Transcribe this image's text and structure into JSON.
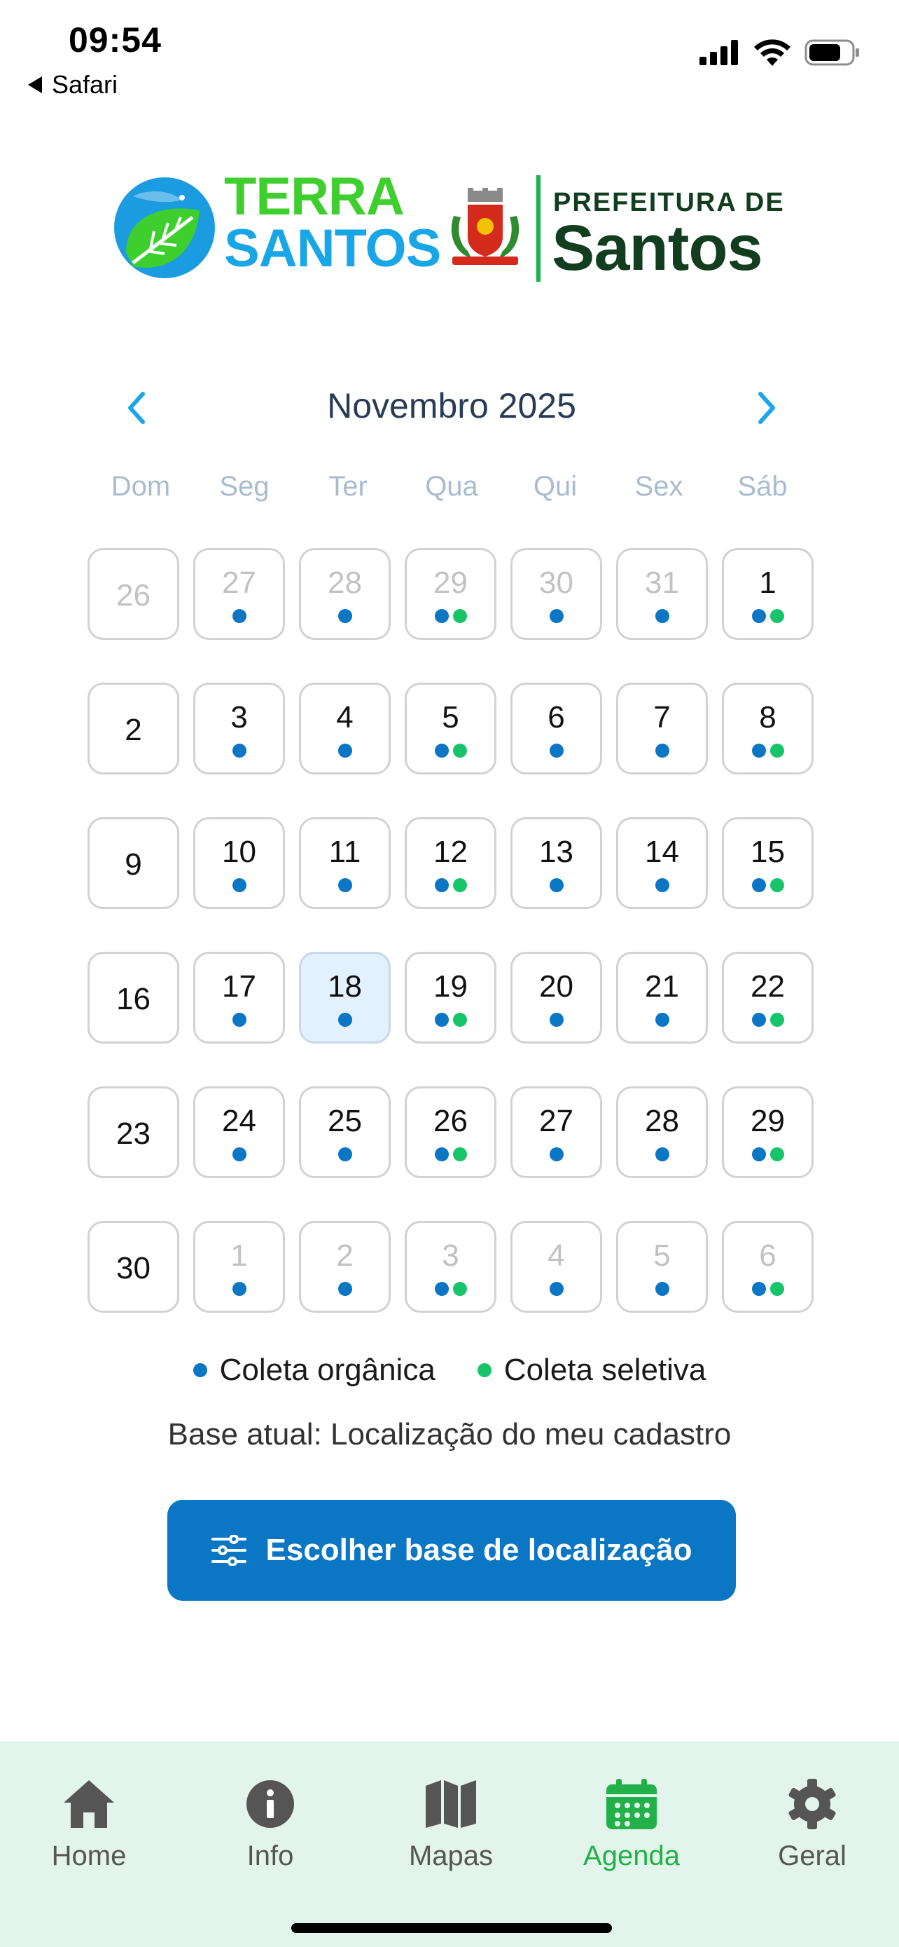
{
  "status_bar": {
    "time": "09:54",
    "back_app": "Safari"
  },
  "logos": {
    "terra_line1": "TERRA",
    "terra_line2": "SANTOS",
    "prefeitura_top": "PREFEITURA DE",
    "prefeitura_big": "Santos"
  },
  "calendar": {
    "month_title": "Novembro 2025",
    "weekdays": [
      "Dom",
      "Seg",
      "Ter",
      "Qua",
      "Qui",
      "Sex",
      "Sáb"
    ],
    "colors": {
      "organica": "#0a76c4",
      "seletiva": "#18c46a"
    },
    "days": [
      {
        "d": "26",
        "other": true,
        "dots": []
      },
      {
        "d": "27",
        "other": true,
        "dots": [
          "organica"
        ]
      },
      {
        "d": "28",
        "other": true,
        "dots": [
          "organica"
        ]
      },
      {
        "d": "29",
        "other": true,
        "dots": [
          "organica",
          "seletiva"
        ]
      },
      {
        "d": "30",
        "other": true,
        "dots": [
          "organica"
        ]
      },
      {
        "d": "31",
        "other": true,
        "dots": [
          "organica"
        ]
      },
      {
        "d": "1",
        "other": false,
        "dots": [
          "organica",
          "seletiva"
        ]
      },
      {
        "d": "2",
        "other": false,
        "dots": []
      },
      {
        "d": "3",
        "other": false,
        "dots": [
          "organica"
        ]
      },
      {
        "d": "4",
        "other": false,
        "dots": [
          "organica"
        ]
      },
      {
        "d": "5",
        "other": false,
        "dots": [
          "organica",
          "seletiva"
        ]
      },
      {
        "d": "6",
        "other": false,
        "dots": [
          "organica"
        ]
      },
      {
        "d": "7",
        "other": false,
        "dots": [
          "organica"
        ]
      },
      {
        "d": "8",
        "other": false,
        "dots": [
          "organica",
          "seletiva"
        ]
      },
      {
        "d": "9",
        "other": false,
        "dots": []
      },
      {
        "d": "10",
        "other": false,
        "dots": [
          "organica"
        ]
      },
      {
        "d": "11",
        "other": false,
        "dots": [
          "organica"
        ]
      },
      {
        "d": "12",
        "other": false,
        "dots": [
          "organica",
          "seletiva"
        ]
      },
      {
        "d": "13",
        "other": false,
        "dots": [
          "organica"
        ]
      },
      {
        "d": "14",
        "other": false,
        "dots": [
          "organica"
        ]
      },
      {
        "d": "15",
        "other": false,
        "dots": [
          "organica",
          "seletiva"
        ]
      },
      {
        "d": "16",
        "other": false,
        "dots": []
      },
      {
        "d": "17",
        "other": false,
        "dots": [
          "organica"
        ]
      },
      {
        "d": "18",
        "other": false,
        "selected": true,
        "dots": [
          "organica"
        ]
      },
      {
        "d": "19",
        "other": false,
        "dots": [
          "organica",
          "seletiva"
        ]
      },
      {
        "d": "20",
        "other": false,
        "dots": [
          "organica"
        ]
      },
      {
        "d": "21",
        "other": false,
        "dots": [
          "organica"
        ]
      },
      {
        "d": "22",
        "other": false,
        "dots": [
          "organica",
          "seletiva"
        ]
      },
      {
        "d": "23",
        "other": false,
        "dots": []
      },
      {
        "d": "24",
        "other": false,
        "dots": [
          "organica"
        ]
      },
      {
        "d": "25",
        "other": false,
        "dots": [
          "organica"
        ]
      },
      {
        "d": "26",
        "other": false,
        "dots": [
          "organica",
          "seletiva"
        ]
      },
      {
        "d": "27",
        "other": false,
        "dots": [
          "organica"
        ]
      },
      {
        "d": "28",
        "other": false,
        "dots": [
          "organica"
        ]
      },
      {
        "d": "29",
        "other": false,
        "dots": [
          "organica",
          "seletiva"
        ]
      },
      {
        "d": "30",
        "other": false,
        "dots": []
      },
      {
        "d": "1",
        "other": true,
        "dots": [
          "organica"
        ]
      },
      {
        "d": "2",
        "other": true,
        "dots": [
          "organica"
        ]
      },
      {
        "d": "3",
        "other": true,
        "dots": [
          "organica",
          "seletiva"
        ]
      },
      {
        "d": "4",
        "other": true,
        "dots": [
          "organica"
        ]
      },
      {
        "d": "5",
        "other": true,
        "dots": [
          "organica"
        ]
      },
      {
        "d": "6",
        "other": true,
        "dots": [
          "organica",
          "seletiva"
        ]
      }
    ]
  },
  "legend": {
    "organica": "Coleta orgânica",
    "seletiva": "Coleta seletiva"
  },
  "base_text": "Base atual: Localização do meu cadastro",
  "choose_button": {
    "label": "Escolher base de localização",
    "icon": "sliders-icon"
  },
  "tabs": [
    {
      "label": "Home",
      "icon": "home-icon",
      "active": false
    },
    {
      "label": "Info",
      "icon": "info-icon",
      "active": false
    },
    {
      "label": "Mapas",
      "icon": "map-icon",
      "active": false
    },
    {
      "label": "Agenda",
      "icon": "calendar-icon",
      "active": true
    },
    {
      "label": "Geral",
      "icon": "gear-icon",
      "active": false
    }
  ]
}
